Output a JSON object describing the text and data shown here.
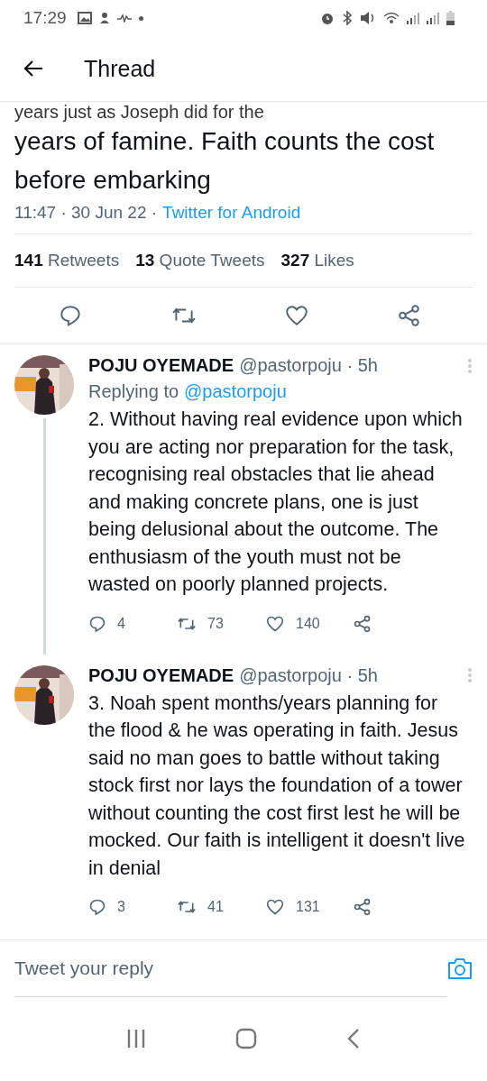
{
  "status_bar": {
    "time": "17:29"
  },
  "header": {
    "title": "Thread"
  },
  "main_tweet": {
    "text_clipped": "years just as Joseph did for the",
    "text": "years of famine. Faith counts the cost before embarking",
    "time": "11:47",
    "separator": "·",
    "date": "30 Jun 22",
    "source": "Twitter for Android",
    "stats": [
      {
        "count": "141",
        "label": "Retweets"
      },
      {
        "count": "13",
        "label": "Quote Tweets"
      },
      {
        "count": "327",
        "label": "Likes"
      }
    ]
  },
  "replies": [
    {
      "name": "POJU OYEMADE",
      "handle": "@pastorpoju",
      "separator": "·",
      "age": "5h",
      "replying_label": "Replying to",
      "replying_to": "@pastorpoju",
      "text": "2. Without having real evidence upon which you are acting nor preparation for the task, recognising real obstacles that lie ahead and making concrete plans, one is just being delusional about the outcome. The enthusiasm of the youth must not be wasted on poorly planned projects.",
      "replies": "4",
      "retweets": "73",
      "likes": "140",
      "thread_continues": true
    },
    {
      "name": "POJU OYEMADE",
      "handle": "@pastorpoju",
      "separator": "·",
      "age": "5h",
      "text": "3. Noah spent months/years planning for the flood & he was operating in faith. Jesus said no man goes to battle without taking stock first nor lays the foundation of a tower without counting the cost first lest he will be mocked. Our faith is intelligent it doesn't live in denial",
      "replies": "3",
      "retweets": "41",
      "likes": "131",
      "thread_continues": false
    }
  ],
  "reply_box": {
    "placeholder": "Tweet your reply"
  }
}
